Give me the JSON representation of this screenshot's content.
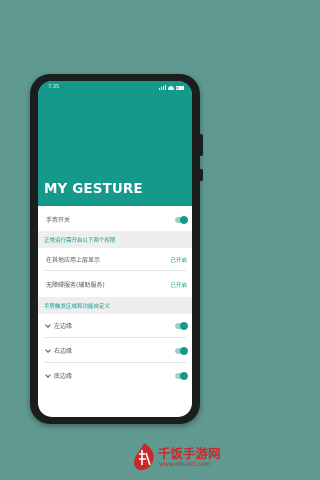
{
  "status_bar": {
    "time": "7:35"
  },
  "app": {
    "title": "MY GESTURE"
  },
  "settings": {
    "gesture_switch": {
      "label": "手势开关",
      "on": true
    },
    "permissions_section": {
      "header": "正常运行需开启以下两个权限"
    },
    "overlay_permission": {
      "label": "在其他应用上层显示",
      "status": "已开启"
    },
    "accessibility_permission": {
      "label": "无障碍服务(辅助服务)",
      "status": "已开启"
    },
    "gesture_area_section": {
      "header": "手势触发区域和功能自定义"
    },
    "edges": [
      {
        "label": "左边缘",
        "on": true
      },
      {
        "label": "右边缘",
        "on": true
      },
      {
        "label": "底边缘",
        "on": true
      }
    ]
  },
  "watermark": {
    "text": "千饭手游网",
    "url": "www.eduext.com"
  },
  "colors": {
    "accent": "#15998a",
    "background": "#5f9990",
    "watermark": "#c72a2a"
  }
}
